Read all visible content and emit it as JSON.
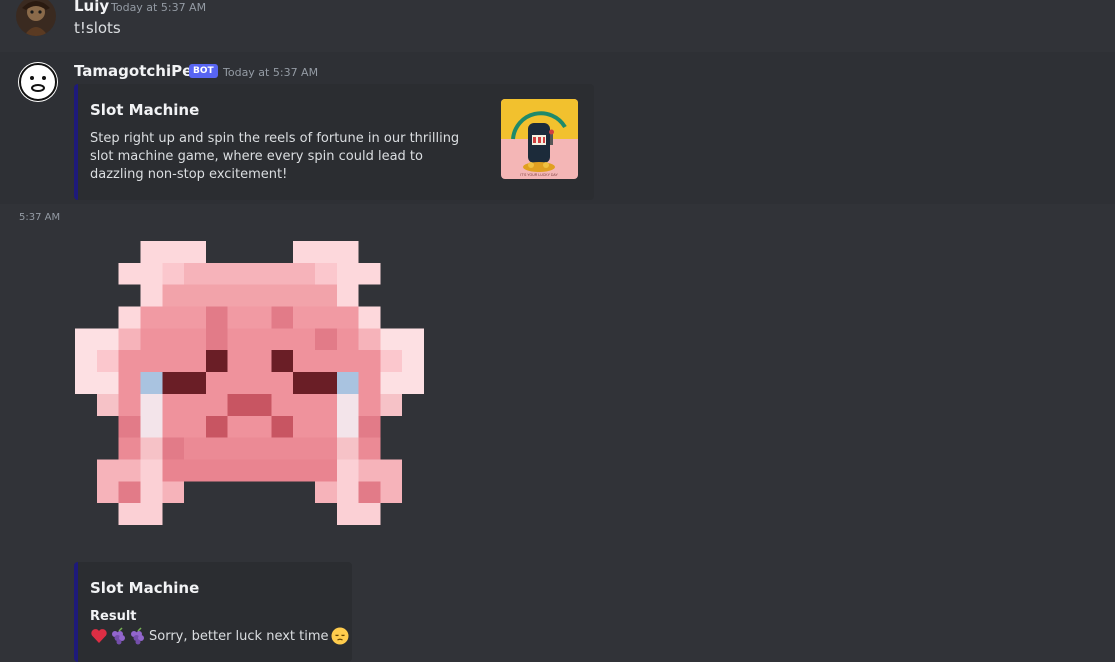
{
  "messages": [
    {
      "author": "Luiy",
      "timestamp": "Today at 5:37 AM",
      "text": "t!slots",
      "avatar_icon": "user-avatar"
    },
    {
      "author": "TamagotchiPets",
      "badge": "BOT",
      "timestamp": "Today at 5:37 AM",
      "avatar_icon": "bot-face-avatar",
      "embed": {
        "title": "Slot Machine",
        "description": "Step right up and spin the reels of fortune in our thrilling slot machine game, where every spin could lead to dazzling non-stop excitement!",
        "thumbnail_icon": "slot-machine-lucky-day-thumbnail",
        "thumbnail_text": "IT'S YOUR LUCKY DAY",
        "accent_color": "#1e1a7a"
      }
    },
    {
      "side_timestamp": "5:37 AM",
      "image_icon": "crying-pink-pig-pixel-art",
      "embed": {
        "title": "Slot Machine",
        "field_name": "Result",
        "field_value": "Sorry, better luck next time",
        "emojis": [
          "heart-emoji",
          "grapes-emoji",
          "grapes-emoji"
        ],
        "trailing_emoji": "pensive-face-emoji"
      }
    }
  ],
  "colors": {
    "background": "#313338",
    "embed_background": "#2b2d31",
    "bot_badge": "#5865f2"
  }
}
